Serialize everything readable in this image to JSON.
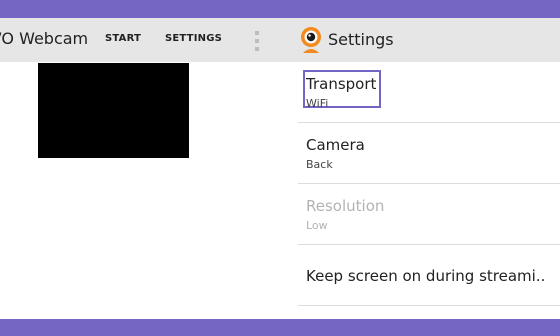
{
  "app_bar": {
    "title": "/O Webcam",
    "actions": [
      {
        "label": "START"
      },
      {
        "label": "SETTINGS"
      }
    ],
    "overflow_icon": "vertical-dots-icon"
  },
  "settings_bar": {
    "icon": "webcam-app-icon",
    "title": "Settings"
  },
  "preferences": [
    {
      "title": "Transport",
      "summary": "WiFi"
    },
    {
      "title": "Camera",
      "summary": "Back"
    },
    {
      "title": "Resolution",
      "summary": "Low"
    },
    {
      "title": "Keep screen on during streami.."
    }
  ],
  "colors": {
    "frame": "#7566c4",
    "bar": "#e6e6e6",
    "focus": "#7165c6",
    "icon_orange": "#f28a1e"
  }
}
